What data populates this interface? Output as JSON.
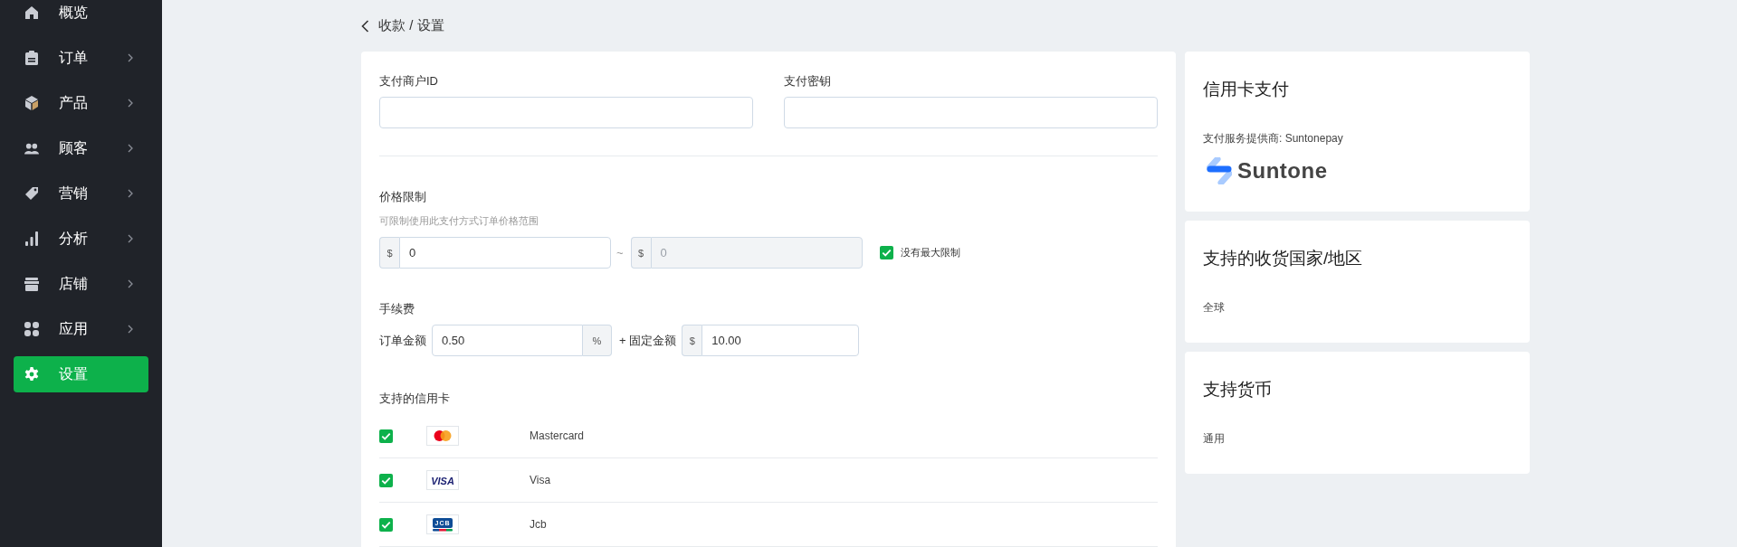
{
  "sidebar": {
    "items": [
      {
        "label": "概览",
        "expandable": false,
        "selected": false
      },
      {
        "label": "订单",
        "expandable": true,
        "selected": false
      },
      {
        "label": "产品",
        "expandable": true,
        "selected": false
      },
      {
        "label": "顾客",
        "expandable": true,
        "selected": false
      },
      {
        "label": "营销",
        "expandable": true,
        "selected": false
      },
      {
        "label": "分析",
        "expandable": true,
        "selected": false
      },
      {
        "label": "店铺",
        "expandable": true,
        "selected": false
      },
      {
        "label": "应用",
        "expandable": true,
        "selected": false
      },
      {
        "label": "设置",
        "expandable": false,
        "selected": true
      }
    ]
  },
  "breadcrumb": {
    "text": "收款 / 设置"
  },
  "credentials": [
    {
      "label": "支付商户ID"
    },
    {
      "label": "支付密钥"
    }
  ],
  "price_limit": {
    "title": "价格限制",
    "hint": "可限制使用此支付方式订单价格范围",
    "min": {
      "prefix": "$",
      "value": "0",
      "disabled": false
    },
    "separator": "~",
    "max": {
      "prefix": "$",
      "value": "0",
      "disabled": true
    },
    "no_max": {
      "label": "没有最大限制",
      "checked": true
    }
  },
  "fee": {
    "title": "手续费",
    "percent_label": "订单金额",
    "percent_value": "0.50",
    "percent_suffix": "%",
    "fixed_label": "+ 固定金额",
    "fixed_prefix": "$",
    "fixed_value": "10.00"
  },
  "cards": {
    "title": "支持的信用卡",
    "items": [
      {
        "kind": "mastercard",
        "name": "Mastercard",
        "checked": true
      },
      {
        "kind": "visa",
        "name": "Visa",
        "checked": true,
        "logo_text": "VISA"
      },
      {
        "kind": "jcb",
        "name": "Jcb",
        "checked": true,
        "logo_text": "JCB"
      }
    ]
  },
  "info_cards": [
    {
      "title": "信用卡支付",
      "text": "支付服务提供商: Suntonepay",
      "logo_text": "Suntone"
    },
    {
      "title": "支持的收货国家/地区",
      "text": "全球"
    },
    {
      "title": "支持货币",
      "text": "通用"
    }
  ]
}
